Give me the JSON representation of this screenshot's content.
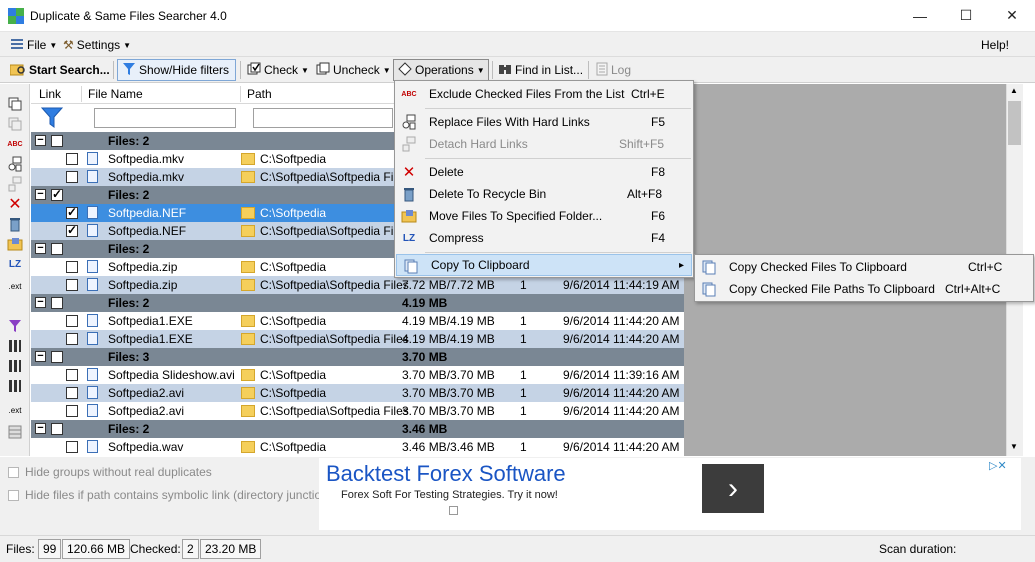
{
  "window": {
    "title": "Duplicate & Same Files Searcher 4.0",
    "minimize": "—",
    "maximize": "☐",
    "close": "✕"
  },
  "menubar": {
    "file": "File",
    "settings": "Settings",
    "help": "Help!"
  },
  "toolbar": {
    "start_search": "Start Search...",
    "show_hide_filters": "Show/Hide filters",
    "check": "Check",
    "uncheck": "Uncheck",
    "operations": "Operations",
    "find_in_list": "Find in List...",
    "log": "Log"
  },
  "list": {
    "columns": {
      "link": "Link",
      "file_name": "File Name",
      "path": "Path"
    },
    "rows": [
      {
        "type": "group",
        "label": "Files: 2",
        "checked": false
      },
      {
        "type": "item",
        "name": "Softpedia.mkv",
        "path": "C:\\Softpedia",
        "checked": false,
        "style": "plain"
      },
      {
        "type": "item",
        "name": "Softpedia.mkv",
        "path": "C:\\Softpedia\\Softpedia Files",
        "checked": false,
        "style": "alt"
      },
      {
        "type": "group",
        "label": "Files: 2",
        "checked": true
      },
      {
        "type": "item",
        "name": "Softpedia.NEF",
        "path": "C:\\Softpedia",
        "checked": true,
        "style": "sel"
      },
      {
        "type": "item",
        "name": "Softpedia.NEF",
        "path": "C:\\Softpedia\\Softpedia Files",
        "checked": true,
        "style": "alt"
      },
      {
        "type": "group",
        "label": "Files: 2",
        "checked": false
      },
      {
        "type": "item",
        "name": "Softpedia.zip",
        "path": "C:\\Softpedia",
        "checked": false,
        "style": "plain"
      },
      {
        "type": "item",
        "name": "Softpedia.zip",
        "path": "C:\\Softpedia\\Softpedia Files",
        "size": "7.72 MB/7.72 MB",
        "links": "1",
        "date": "9/6/2014 11:44:19 AM",
        "checked": false,
        "style": "alt"
      },
      {
        "type": "group",
        "label": "Files: 2",
        "size": "4.19 MB",
        "checked": false
      },
      {
        "type": "item",
        "name": "Softpedia1.EXE",
        "path": "C:\\Softpedia",
        "size": "4.19 MB/4.19 MB",
        "links": "1",
        "date": "9/6/2014 11:44:20 AM",
        "checked": false,
        "style": "plain"
      },
      {
        "type": "item",
        "name": "Softpedia1.EXE",
        "path": "C:\\Softpedia\\Softpedia Files",
        "size": "4.19 MB/4.19 MB",
        "links": "1",
        "date": "9/6/2014 11:44:20 AM",
        "checked": false,
        "style": "alt"
      },
      {
        "type": "group",
        "label": "Files: 3",
        "size": "3.70 MB",
        "checked": false
      },
      {
        "type": "item",
        "name": "Softpedia Slideshow.avi",
        "path": "C:\\Softpedia",
        "size": "3.70 MB/3.70 MB",
        "links": "1",
        "date": "9/6/2014 11:39:16 AM",
        "checked": false,
        "style": "plain"
      },
      {
        "type": "item",
        "name": "Softpedia2.avi",
        "path": "C:\\Softpedia",
        "size": "3.70 MB/3.70 MB",
        "links": "1",
        "date": "9/6/2014 11:44:20 AM",
        "checked": false,
        "style": "alt"
      },
      {
        "type": "item",
        "name": "Softpedia2.avi",
        "path": "C:\\Softpedia\\Softpedia Files",
        "size": "3.70 MB/3.70 MB",
        "links": "1",
        "date": "9/6/2014 11:44:20 AM",
        "checked": false,
        "style": "plain"
      },
      {
        "type": "group",
        "label": "Files: 2",
        "size": "3.46 MB",
        "checked": false
      },
      {
        "type": "item",
        "name": "Softpedia.wav",
        "path": "C:\\Softpedia",
        "size": "3.46 MB/3.46 MB",
        "links": "1",
        "date": "9/6/2014 11:44:20 AM",
        "checked": false,
        "style": "plain"
      }
    ]
  },
  "operations_menu": {
    "exclude": {
      "label": "Exclude Checked Files From the List",
      "shortcut": "Ctrl+E"
    },
    "replace": {
      "label": "Replace Files With Hard Links",
      "shortcut": "F5"
    },
    "detach": {
      "label": "Detach Hard Links",
      "shortcut": "Shift+F5"
    },
    "delete": {
      "label": "Delete",
      "shortcut": "F8"
    },
    "recycle": {
      "label": "Delete To Recycle Bin",
      "shortcut": "Alt+F8"
    },
    "move": {
      "label": "Move Files To Specified Folder...",
      "shortcut": "F6"
    },
    "compress": {
      "label": "Compress",
      "shortcut": "F4"
    },
    "copy_to_clipboard": {
      "label": "Copy To Clipboard",
      "arrow": "▸"
    }
  },
  "clipboard_submenu": {
    "copy_files": {
      "label": "Copy Checked Files To Clipboard",
      "shortcut": "Ctrl+C"
    },
    "copy_paths": {
      "label": "Copy Checked File Paths To Clipboard",
      "shortcut": "Ctrl+Alt+C"
    }
  },
  "options": {
    "hide_groups": "Hide groups without real duplicates",
    "hide_symlinks": "Hide files if path contains symbolic link (directory junction)"
  },
  "ad": {
    "headline": "Backtest Forex Software",
    "subline": "Forex Soft For Testing Strategies. Try it now!",
    "arrow": "›",
    "adchoices": "▷✕"
  },
  "statusbar": {
    "files_label": "Files:",
    "files_count": "99",
    "files_size": "120.66 MB",
    "checked_label": "Checked:",
    "checked_count": "2",
    "checked_size": "23.20 MB",
    "scan_duration_label": "Scan duration:"
  },
  "icons": {
    "lz": "LZ",
    "abc": "ABC",
    "ext": ".ext"
  }
}
